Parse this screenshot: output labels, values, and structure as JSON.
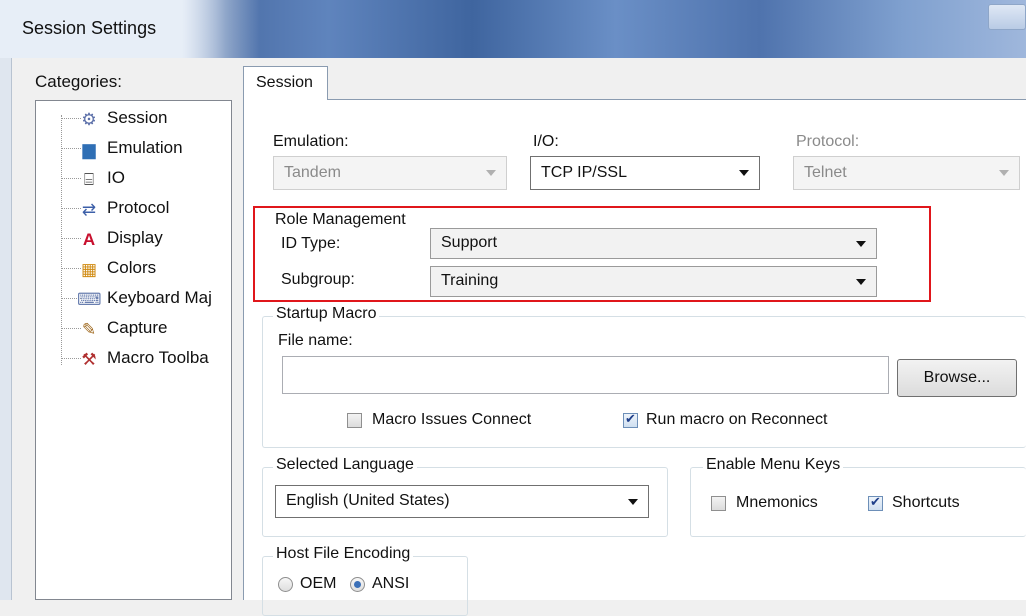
{
  "window": {
    "title": "Session Settings"
  },
  "categories": {
    "label": "Categories:",
    "items": [
      {
        "label": "Session",
        "icon": "gear-icon"
      },
      {
        "label": "Emulation",
        "icon": "monitor-icon"
      },
      {
        "label": "IO",
        "icon": "io-icon"
      },
      {
        "label": "Protocol",
        "icon": "protocol-icon"
      },
      {
        "label": "Display",
        "icon": "font-icon"
      },
      {
        "label": "Colors",
        "icon": "palette-icon"
      },
      {
        "label": "Keyboard Maj",
        "icon": "keyboard-icon"
      },
      {
        "label": "Capture",
        "icon": "pencil-icon"
      },
      {
        "label": "Macro Toolba",
        "icon": "tools-icon"
      }
    ]
  },
  "tabs": [
    {
      "label": "Session",
      "active": true
    }
  ],
  "session": {
    "emulation": {
      "label": "Emulation:",
      "value": "Tandem",
      "enabled": false
    },
    "io": {
      "label": "I/O:",
      "value": "TCP IP/SSL",
      "enabled": true
    },
    "protocol": {
      "label": "Protocol:",
      "value": "Telnet",
      "enabled": false
    },
    "role_management": {
      "legend": "Role Management",
      "id_type": {
        "label": "ID Type:",
        "value": "Support"
      },
      "subgroup": {
        "label": "Subgroup:",
        "value": "Training"
      }
    },
    "startup_macro": {
      "legend": "Startup Macro",
      "file_label": "File name:",
      "file_value": "",
      "browse_label": "Browse...",
      "macro_issues_connect": {
        "label": "Macro Issues Connect",
        "checked": false
      },
      "run_on_reconnect": {
        "label": "Run macro on Reconnect",
        "checked": true
      }
    },
    "language": {
      "legend": "Selected Language",
      "value": "English (United States)"
    },
    "menu_keys": {
      "legend": "Enable Menu Keys",
      "mnemonics": {
        "label": "Mnemonics",
        "checked": false
      },
      "shortcuts": {
        "label": "Shortcuts",
        "checked": true
      }
    },
    "host_encoding": {
      "legend": "Host File Encoding",
      "oem": {
        "label": "OEM",
        "selected": false
      },
      "ansi": {
        "label": "ANSI",
        "selected": true
      }
    }
  },
  "colors": {
    "highlight_border": "#e0161b",
    "titlebar_accent": "#4b6ea6"
  }
}
